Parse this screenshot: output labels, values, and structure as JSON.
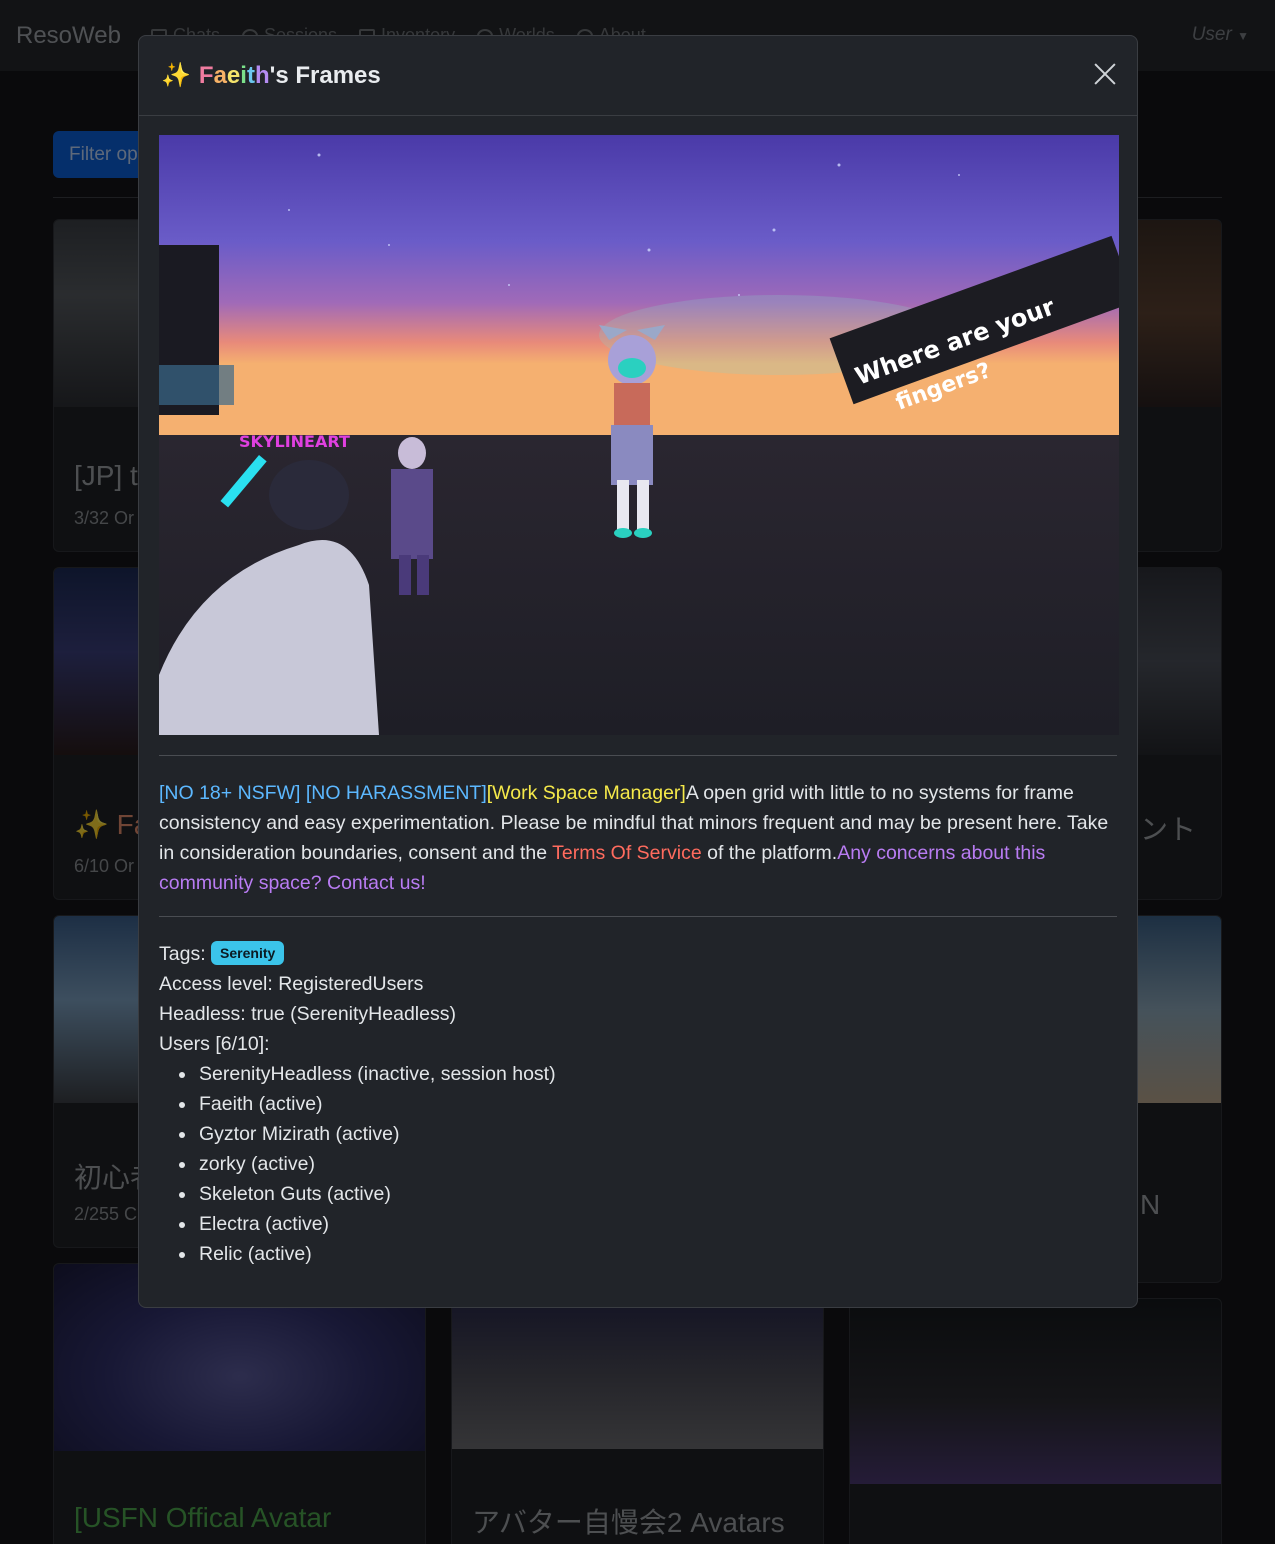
{
  "navbar": {
    "brand": "ResoWeb",
    "items": [
      "Chats",
      "Sessions",
      "Inventory",
      "Worlds",
      "About"
    ],
    "user_label": "User"
  },
  "background": {
    "filter_label": "Filter op",
    "cards": [
      {
        "title": "[JP] t",
        "sub": "3/32 Or"
      },
      {
        "title": "✨ Fa",
        "sub": "6/10 Or"
      },
      {
        "title": "初心者",
        "sub": "2/255 C"
      },
      {
        "title": "[USFN Offical Avatar",
        "sub": ""
      },
      {
        "title": "アバター自慢会2 Avatars",
        "sub": ""
      },
      {
        "title": "ント",
        "sub": ""
      },
      {
        "title": "N",
        "sub": ""
      }
    ]
  },
  "modal": {
    "title_prefix": "✨",
    "title_rainbow": [
      "F",
      "a",
      "e",
      "i",
      "t",
      "h"
    ],
    "title_suffix": "'s Frames",
    "description": {
      "tag_rules": "[NO 18+ NSFW] [NO HARASSMENT]",
      "tag_manager": "[Work Space Manager]",
      "body": "A open grid with little to no systems for frame consistency and easy experimentation. Please be mindful that minors frequent and may be present here. Take in consideration boundaries, consent and the ",
      "tos_link": "Terms Of Service",
      "after_tos": " of the platform.",
      "contact_link": "Any concerns about this community space? Contact us!"
    },
    "tags_label": "Tags:",
    "tag": "Serenity",
    "access_level": "Access level: RegisteredUsers",
    "headless": "Headless: true (SerenityHeadless)",
    "users_label": "Users [6/10]:",
    "users": [
      "SerenityHeadless (inactive, session host)",
      "Faeith (active)",
      "Gyztor Mizirath (active)",
      "zorky (active)",
      "Skeleton Guts (active)",
      "Electra (active)",
      "Relic (active)"
    ],
    "hero_image_text": "Where are your fingers?"
  },
  "colors": {
    "primary": "#0b5ed7",
    "badge": "#3bc4ea",
    "link_blue": "#5cb8ff",
    "link_yellow": "#f5e94a",
    "link_red": "#ff6b5e",
    "link_purple": "#b97cf3"
  }
}
